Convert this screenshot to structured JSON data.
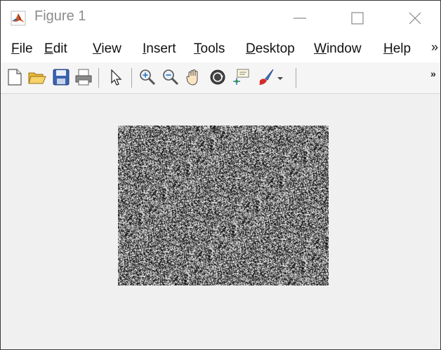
{
  "window": {
    "title": "Figure 1",
    "icon": "matlab-logo-icon",
    "controls": [
      "minimize-icon",
      "maximize-icon",
      "close-icon"
    ]
  },
  "menubar": {
    "items": [
      {
        "accel": "F",
        "rest": "ile"
      },
      {
        "accel": "E",
        "rest": "dit"
      },
      {
        "accel": "V",
        "rest": "iew"
      },
      {
        "accel": "I",
        "rest": "nsert"
      },
      {
        "accel": "T",
        "rest": "ools"
      },
      {
        "accel": "D",
        "rest": "esktop"
      },
      {
        "accel": "W",
        "rest": "indow"
      },
      {
        "accel": "H",
        "rest": "elp"
      }
    ],
    "overflow": "»"
  },
  "toolbar": {
    "icons": [
      "new-figure-icon",
      "open-file-icon",
      "save-icon",
      "print-icon",
      "edit-plot-arrow-icon",
      "zoom-in-icon",
      "zoom-out-icon",
      "pan-hand-icon",
      "rotate-3d-icon",
      "data-cursor-icon",
      "brush-icon",
      "brush-dropdown-icon"
    ],
    "overflow": "»"
  },
  "figure": {
    "content": "random noise image",
    "background": "#f0f0f0"
  }
}
